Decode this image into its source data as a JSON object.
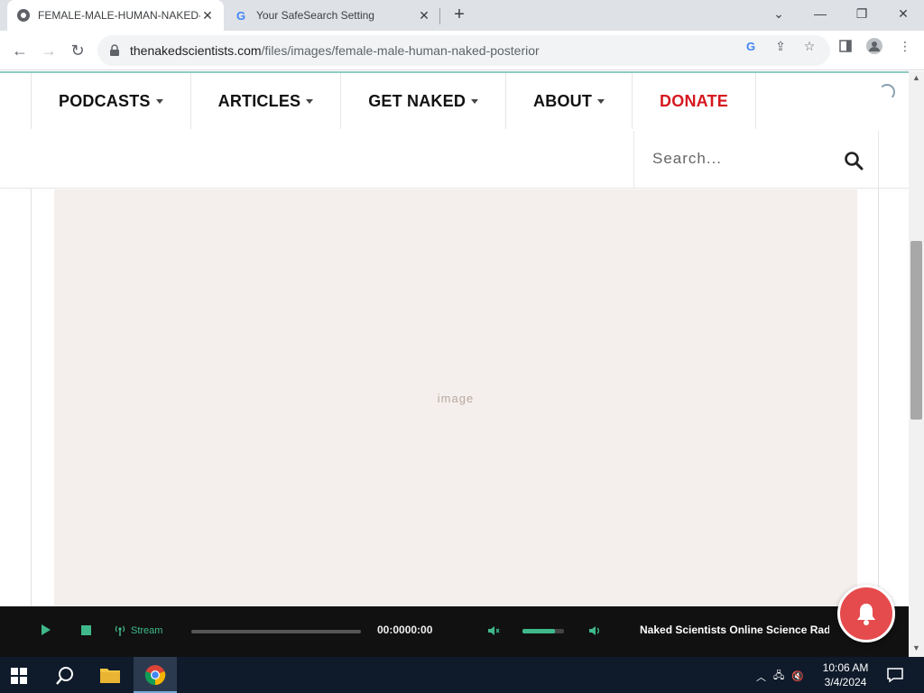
{
  "browser": {
    "tabs": [
      {
        "title": "FEMALE-MALE-HUMAN-NAKED-POSTERIOR",
        "active": true,
        "favicon": "naked-scientists-favicon"
      },
      {
        "title": "Your SafeSearch Setting",
        "active": false,
        "favicon": "google-g-icon"
      }
    ],
    "new_tab_label": "+",
    "url_host": "thenakedscientists.com",
    "url_path": "/files/images/female-male-human-naked-posterior",
    "window_controls": [
      "minimize-icon",
      "restore-icon",
      "close-icon"
    ]
  },
  "site": {
    "menu": [
      {
        "label": "PODCASTS",
        "dropdown": true
      },
      {
        "label": "ARTICLES",
        "dropdown": true
      },
      {
        "label": "GET NAKED",
        "dropdown": true
      },
      {
        "label": "ABOUT",
        "dropdown": true
      },
      {
        "label": "DONATE",
        "dropdown": false
      }
    ],
    "search_placeholder": "Search...",
    "colors": {
      "accent_teal": "#8ecbc0",
      "donate_red": "#d6181f",
      "player_green": "#3fb98a",
      "bell_red": "#e54b4d"
    }
  },
  "player": {
    "stream_label": "Stream",
    "time": "00:0000:00",
    "volume_level": 0.78,
    "now_playing": "Naked Scientists Online Science Radio"
  },
  "taskbar": {
    "time": "10:06 AM",
    "date": "3/4/2024"
  }
}
